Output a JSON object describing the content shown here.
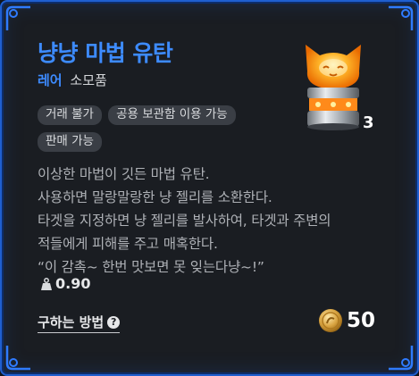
{
  "item": {
    "name": "냥냥 마법 유탄",
    "grade": "레어",
    "category": "소모품",
    "count": "3",
    "tags": [
      "거래 불가",
      "공용 보관함 이용 가능",
      "판매 가능"
    ],
    "description_lines": [
      "이상한 마법이 깃든 마법 유탄.",
      "사용하면 말랑말랑한 냥 젤리를 소환한다.",
      "타겟을 지정하면 냥 젤리를 발사하여, 타겟과 주변의",
      "적들에게 피해를 주고 매혹한다.",
      "“이 감촉~ 한번 맛보면 못 잊는다냥~!”"
    ],
    "weight": "0.90",
    "price": "50"
  },
  "footer": {
    "how_to_get_label": "구하는 방법"
  },
  "icons": {
    "weight": "weight-icon",
    "help": "question-icon",
    "currency": "coin-icon"
  },
  "colors": {
    "title": "#3d8bff",
    "border": "#1f5fd0",
    "background": "#1a1d22"
  }
}
